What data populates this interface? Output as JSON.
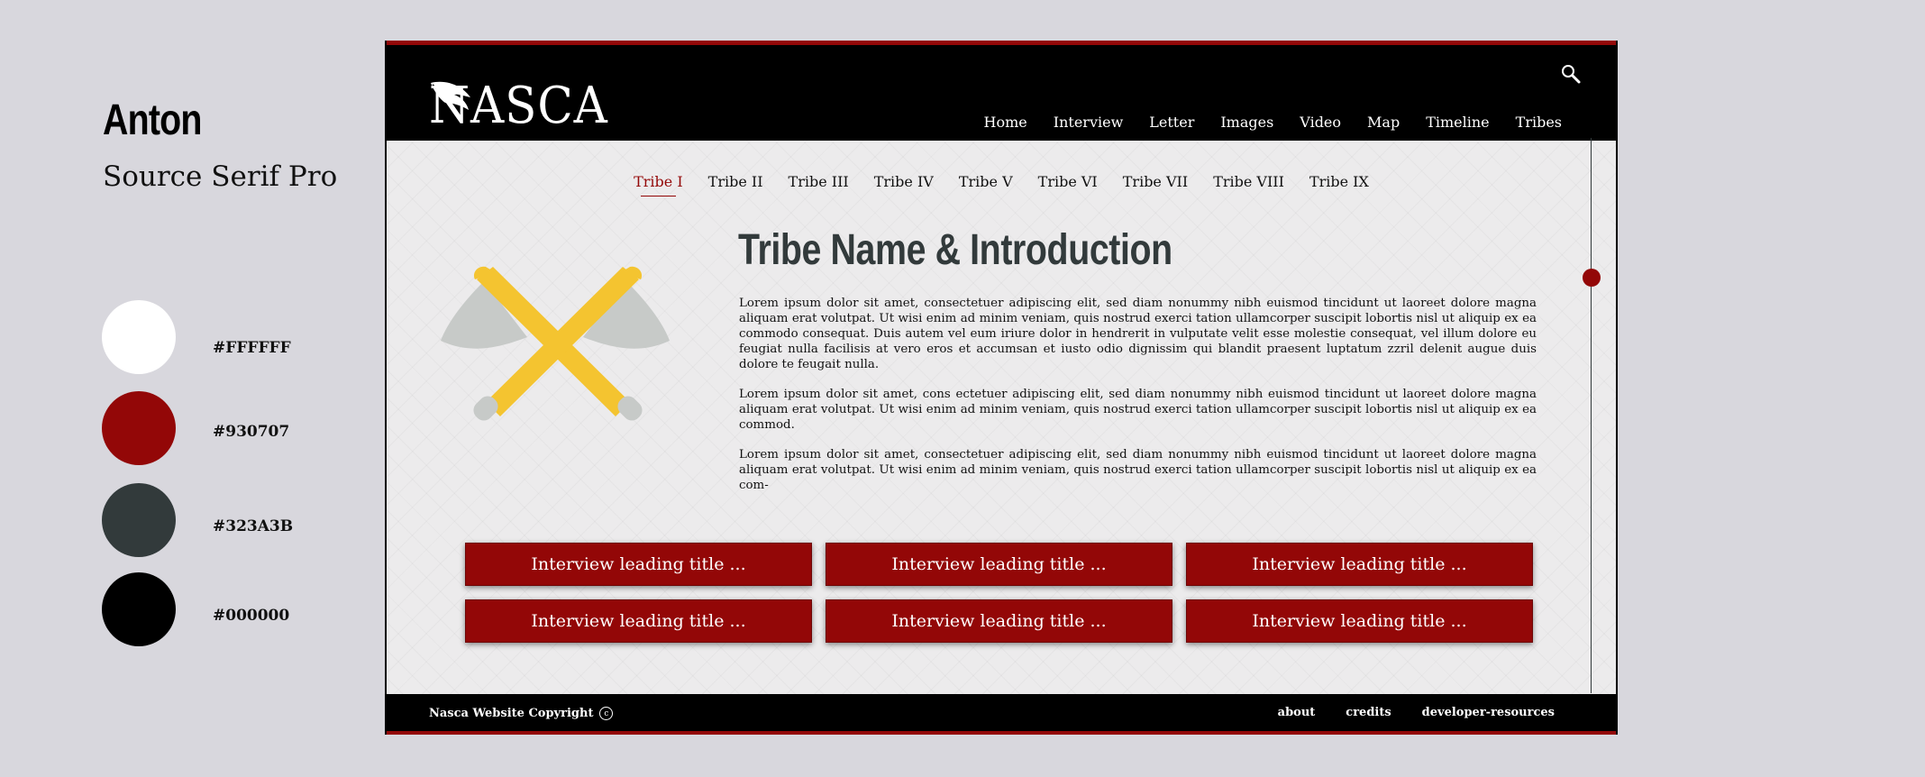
{
  "style_guide": {
    "heading_font": "Anton",
    "body_font": "Source Serif Pro",
    "swatches": [
      {
        "color": "#FFFFFF",
        "label": "#FFFFFF"
      },
      {
        "color": "#930707",
        "label": "#930707"
      },
      {
        "color": "#323A3B",
        "label": "#323A3B"
      },
      {
        "color": "#000000",
        "label": "#000000"
      }
    ]
  },
  "header": {
    "logo_text": "NASCA",
    "nav": [
      "Home",
      "Interview",
      "Letter",
      "Images",
      "Video",
      "Map",
      "Timeline",
      "Tribes"
    ]
  },
  "tabs": {
    "items": [
      "Tribe I",
      "Tribe II",
      "Tribe III",
      "Tribe IV",
      "Tribe V",
      "Tribe VI",
      "Tribe VII",
      "Tribe VIII",
      "Tribe IX"
    ],
    "active": "Tribe I"
  },
  "main": {
    "title": "Tribe Name & Introduction",
    "paragraphs": [
      "Lorem ipsum dolor sit amet, consectetuer adipiscing elit, sed diam nonummy nibh euismod tincidunt ut laoreet dolore magna aliquam erat volutpat. Ut wisi enim ad minim veniam, quis nostrud exerci tation ullamcorper suscipit lobortis nisl ut aliquip ex ea commodo consequat. Duis autem vel eum iriure dolor in hendrerit in vulputate velit esse molestie consequat, vel illum dolore eu feugiat nulla facilisis at vero eros et accumsan et iusto odio dignissim qui blandit praesent luptatum zzril delenit augue duis dolore te feugait nulla.",
      "Lorem ipsum dolor sit amet, cons ectetuer adipiscing elit, sed diam nonummy nibh euismod tincidunt ut laoreet dolore magna aliquam erat volutpat. Ut wisi enim ad minim veniam, quis nostrud exerci tation ullamcorper suscipit lobortis nisl ut aliquip ex ea commod.",
      "Lorem ipsum dolor sit amet, consectetuer adipiscing elit, sed diam nonummy nibh euismod tincidunt ut laoreet dolore magna aliquam erat volutpat. Ut wisi enim ad minim veniam, quis nostrud exerci tation ullamcorper suscipit lobortis nisl ut aliquip ex ea com-"
    ],
    "interview_buttons": [
      "Interview leading title ...",
      "Interview leading title ...",
      "Interview leading title ...",
      "Interview leading title ...",
      "Interview leading title ...",
      "Interview leading title ..."
    ]
  },
  "footer": {
    "copyright": "Nasca Website Copyright",
    "copyright_symbol": "c",
    "links": [
      "about",
      "credits",
      "developer-resources"
    ]
  },
  "icons": {
    "logo_mark": "feather-icon",
    "search": "search-icon",
    "hero": "crossed-axes-icon",
    "timeline_marker": "timeline-dot"
  }
}
